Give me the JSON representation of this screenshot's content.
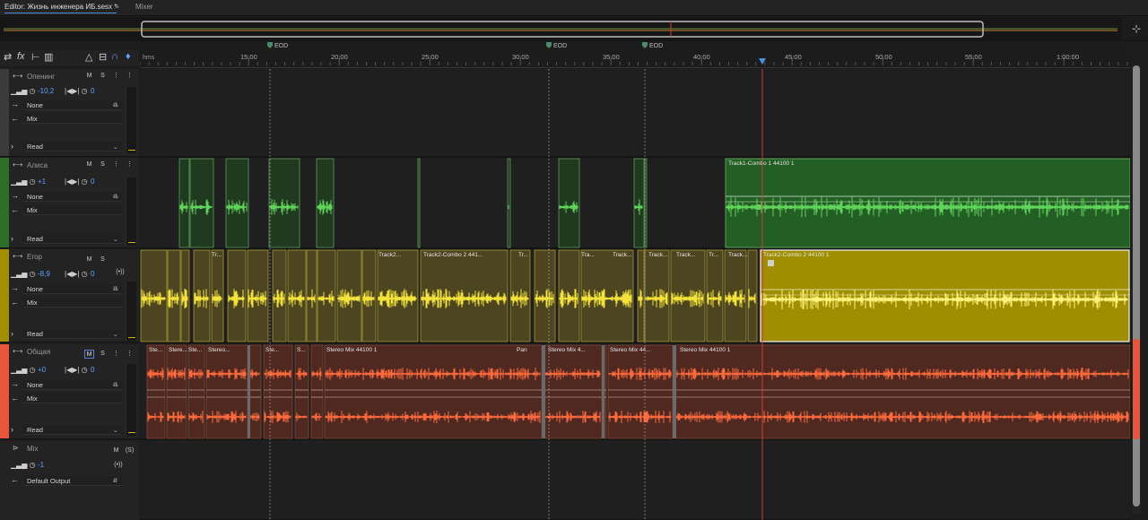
{
  "tabs": {
    "editor_label": "Editor: Жизнь инженера ИБ.sesx *",
    "menu_glyph": "≡",
    "mixer_label": "Mixer"
  },
  "ruler": {
    "unit_label": "hms",
    "time_labels": [
      "15:00",
      "20:00",
      "25:00",
      "30:00",
      "35:00",
      "40:00",
      "45:00",
      "50:00",
      "55:00",
      "1:00:00"
    ],
    "markers": [
      "EOD",
      "EOD",
      "EOD"
    ],
    "playhead_time": "43:30"
  },
  "colors": {
    "track1": "#3b3b3b",
    "track2": "#2f6e2a",
    "track3": "#a08f00",
    "track4": "#e8553a",
    "wave_green": "#5fd35a",
    "wave_yellow": "#f3e23a",
    "wave_orange": "#ff6a3d",
    "playhead": "#d23b3b"
  },
  "tracks": [
    {
      "name": "Опенинг",
      "volume": "-10,2",
      "pan": "0",
      "input": "None",
      "output": "Mix",
      "automation": "Read",
      "m": "M",
      "s": "S",
      "r": "⋮",
      "i": "⋮",
      "clips": []
    },
    {
      "name": "Алиса",
      "volume": "+1",
      "pan": "0",
      "input": "None",
      "output": "Mix",
      "automation": "Read",
      "m": "M",
      "s": "S",
      "r": "⋮",
      "i": "⋮",
      "clips": [
        {
          "label": "Track1-Combo 1 44100 1"
        }
      ]
    },
    {
      "name": "Егор",
      "volume": "-8,9",
      "pan": "0",
      "input": "None",
      "output": "Mix",
      "automation": "Read",
      "m": "M",
      "s": "S",
      "r": "(•))",
      "clips": [
        {
          "label": "Tr..."
        },
        {
          "label": "Track2..."
        },
        {
          "label": "Track2-Combo 2 441..."
        },
        {
          "label": "Tr..."
        },
        {
          "label": "Tra..."
        },
        {
          "label": "Track..."
        },
        {
          "label": "Track..."
        },
        {
          "label": "Track..."
        },
        {
          "label": "Tr..."
        },
        {
          "label": "Track..."
        },
        {
          "label": "Track2-Combo 2 44100 1"
        }
      ]
    },
    {
      "name": "Общая",
      "volume": "+0",
      "pan": "0",
      "input": "None",
      "output": "Mix",
      "automation": "Read",
      "m": "M",
      "s": "S",
      "r": "⋮",
      "i": "⋮",
      "clips": [
        {
          "label": "Ste..."
        },
        {
          "label": "Stere..."
        },
        {
          "label": "Ste..."
        },
        {
          "label": "Stereo..."
        },
        {
          "label": "Ste..."
        },
        {
          "label": "S..."
        },
        {
          "label": "Stereo Mix 44100 1"
        },
        {
          "label": "Pan"
        },
        {
          "label": "Stereo Mix 4..."
        },
        {
          "label": "Stereo Mix 44..."
        },
        {
          "label": "Stereo Mix 44100 1"
        }
      ]
    }
  ],
  "mix_track": {
    "name": "Mix",
    "volume": "-1",
    "output": "Default Output",
    "m": "M",
    "s": "(S)",
    "r": "(•))"
  }
}
